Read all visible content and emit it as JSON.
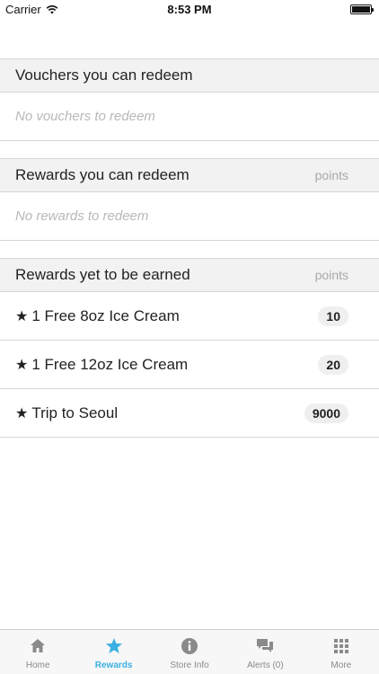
{
  "status_bar": {
    "carrier": "Carrier",
    "time": "8:53 PM"
  },
  "sections": {
    "vouchers": {
      "title": "Vouchers you can redeem",
      "empty_text": "No vouchers to redeem"
    },
    "redeemable": {
      "title": "Rewards you can redeem",
      "points_label": "points",
      "empty_text": "No rewards to redeem"
    },
    "to_earn": {
      "title": "Rewards yet to be earned",
      "points_label": "points",
      "items": [
        {
          "star": "★",
          "name": "1 Free 8oz Ice Cream",
          "points": "10"
        },
        {
          "star": "★",
          "name": "1 Free 12oz Ice Cream",
          "points": "20"
        },
        {
          "star": "★",
          "name": "Trip to Seoul",
          "points": "9000"
        }
      ]
    }
  },
  "tab_bar": {
    "active_color": "#3ab0e2",
    "tabs": [
      {
        "label": "Home",
        "icon": "home-icon"
      },
      {
        "label": "Rewards",
        "icon": "star-icon"
      },
      {
        "label": "Store Info",
        "icon": "info-icon"
      },
      {
        "label": "Alerts (0)",
        "icon": "chat-bubbles-icon"
      },
      {
        "label": "More",
        "icon": "grid-icon"
      }
    ]
  }
}
